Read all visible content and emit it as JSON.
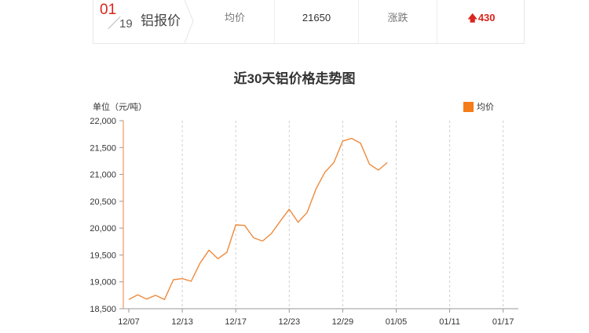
{
  "price_strip": {
    "date_month": "01",
    "date_day": "19",
    "title": "铝报价",
    "avg_label": "均价",
    "avg_value": "21650",
    "change_label": "涨跌",
    "change_value": "430",
    "change_icon": "up-arrow-icon",
    "change_color": "#d9251d"
  },
  "chart_data": {
    "type": "line",
    "title": "近30天铝价格走势图",
    "ylabel": "单位（元/吨）",
    "ylim": [
      18500,
      22000
    ],
    "y_ticks": [
      "18,500",
      "19,000",
      "19,500",
      "20,000",
      "20,500",
      "21,000",
      "21,500",
      "22,000"
    ],
    "y_tick_values": [
      18500,
      19000,
      19500,
      20000,
      20500,
      21000,
      21500,
      22000
    ],
    "x_tick_labels": [
      "12/07",
      "12/13",
      "12/17",
      "12/23",
      "12/29",
      "01/05",
      "01/11",
      "01/17"
    ],
    "x_tick_indices": [
      0,
      6,
      12,
      18,
      24,
      30,
      36,
      42
    ],
    "grid": "vertical dashed",
    "legend_position": "top-right",
    "series": [
      {
        "name": "均价",
        "color": "#ee8a3c",
        "legend_color": "#f57c19",
        "values": [
          18670,
          18760,
          18680,
          18750,
          18670,
          19040,
          19060,
          19010,
          19350,
          19590,
          19430,
          19550,
          20060,
          20050,
          19820,
          19760,
          19900,
          20130,
          20350,
          20110,
          20290,
          20730,
          21040,
          21220,
          21620,
          21670,
          21580,
          21190,
          21080,
          21220
        ]
      }
    ]
  }
}
